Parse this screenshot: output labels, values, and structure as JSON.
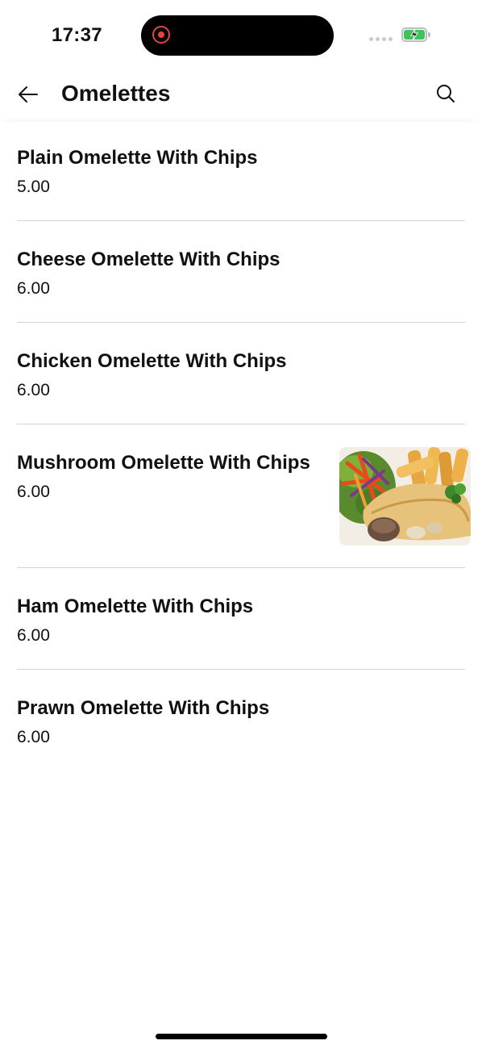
{
  "status_bar": {
    "time": "17:37"
  },
  "header": {
    "title": "Omelettes",
    "back_icon": "arrow-left-icon",
    "search_icon": "search-icon"
  },
  "menu": {
    "items": [
      {
        "name": "Plain Omelette With Chips",
        "price": "5.00"
      },
      {
        "name": "Cheese Omelette With Chips",
        "price": "6.00"
      },
      {
        "name": "Chicken Omelette With Chips",
        "price": "6.00"
      },
      {
        "name": "Mushroom Omelette With Chips",
        "price": "6.00"
      },
      {
        "name": "Ham Omelette With Chips",
        "price": "6.00"
      },
      {
        "name": "Prawn Omelette With Chips",
        "price": "6.00"
      }
    ]
  },
  "colors": {
    "accent": "#3fc35a",
    "recording": "#e0463f",
    "divider": "#d4d4d4"
  }
}
